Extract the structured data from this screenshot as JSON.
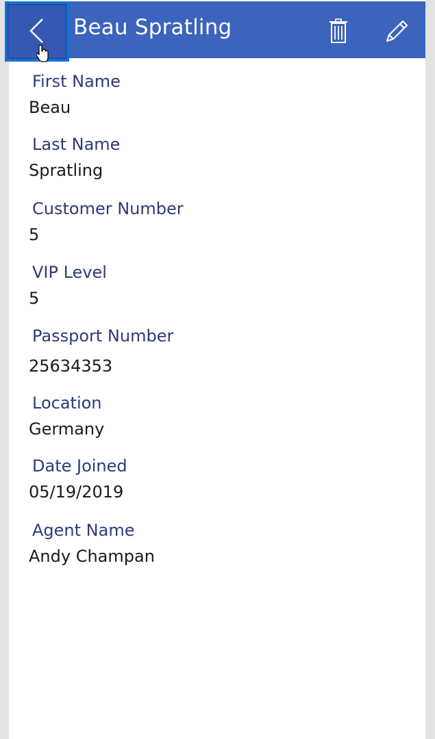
{
  "header": {
    "title": "Beau Spratling",
    "back_icon": "chevron-left-icon",
    "delete_icon": "trash-icon",
    "edit_icon": "pencil-icon",
    "accent_color": "#3c64bc",
    "focus_color": "#1273d8"
  },
  "fields": [
    {
      "label": "First Name",
      "value": "Beau"
    },
    {
      "label": "Last Name",
      "value": "Spratling"
    },
    {
      "label": "Customer Number",
      "value": "5"
    },
    {
      "label": "VIP Level",
      "value": "5"
    },
    {
      "label": "Passport Number",
      "value": "25634353"
    },
    {
      "label": "Location",
      "value": "Germany"
    },
    {
      "label": "Date Joined",
      "value": "05/19/2019"
    },
    {
      "label": "Agent Name",
      "value": "Andy Champan"
    }
  ]
}
